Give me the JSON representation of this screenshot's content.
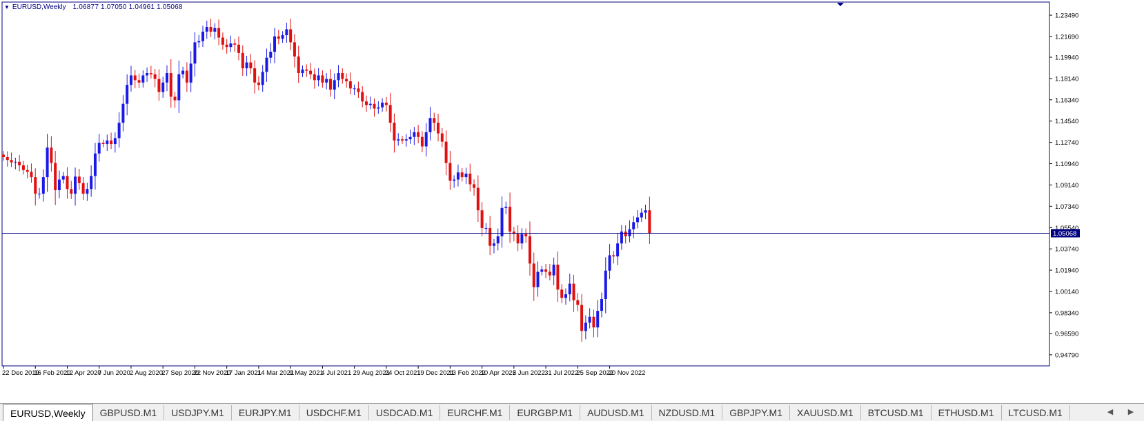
{
  "header": {
    "symbol_label": "EURUSD,Weekly",
    "ohlc_label": "1.06877 1.07050 1.04961 1.05068"
  },
  "colors": {
    "bull": "#1a1ae6",
    "bear": "#e01010",
    "frame": "#000080",
    "price_line": "#000080",
    "price_box": "#000080"
  },
  "tabs": [
    {
      "label": "EURUSD,Weekly",
      "active": true
    },
    {
      "label": "GBPUSD.M1",
      "active": false
    },
    {
      "label": "USDJPY.M1",
      "active": false
    },
    {
      "label": "EURJPY.M1",
      "active": false
    },
    {
      "label": "USDCHF.M1",
      "active": false
    },
    {
      "label": "USDCAD.M1",
      "active": false
    },
    {
      "label": "EURCHF.M1",
      "active": false
    },
    {
      "label": "EURGBP.M1",
      "active": false
    },
    {
      "label": "AUDUSD.M1",
      "active": false
    },
    {
      "label": "NZDUSD.M1",
      "active": false
    },
    {
      "label": "GBPJPY.M1",
      "active": false
    },
    {
      "label": "XAUUSD.M1",
      "active": false
    },
    {
      "label": "BTCUSD.M1",
      "active": false
    },
    {
      "label": "ETHUSD.M1",
      "active": false
    },
    {
      "label": "LTCUSD.M1",
      "active": false
    }
  ],
  "tab_icons": {
    "left": "scroll-left-icon",
    "right": "scroll-right-icon"
  },
  "chart_data": {
    "type": "candlestick",
    "symbol": "EURUSD",
    "timeframe": "Weekly",
    "current_price": 1.05068,
    "current_price_label": "1.05068",
    "ylim": [
      0.9385,
      1.246
    ],
    "grid": false,
    "y_ticks": [
      1.2349,
      1.2169,
      1.1994,
      1.1814,
      1.1634,
      1.1454,
      1.1274,
      1.1094,
      1.0914,
      1.0734,
      1.0554,
      1.0374,
      1.0194,
      1.0014,
      0.9834,
      0.9659,
      0.9479
    ],
    "y_tick_labels": [
      "1.23490",
      "1.21690",
      "1.19940",
      "1.18140",
      "1.16340",
      "1.14540",
      "1.12740",
      "1.10940",
      "1.09140",
      "1.07340",
      "1.05540",
      "1.03740",
      "1.01940",
      "1.00140",
      "0.98340",
      "0.96590",
      "0.94790"
    ],
    "x_ticks": [
      {
        "label": "22 Dec 2019",
        "index": 0
      },
      {
        "label": "16 Feb 2020",
        "index": 8
      },
      {
        "label": "12 Apr 2020",
        "index": 16
      },
      {
        "label": "7 Jun 2020",
        "index": 24
      },
      {
        "label": "2 Aug 2020",
        "index": 32
      },
      {
        "label": "27 Sep 2020",
        "index": 40
      },
      {
        "label": "22 Nov 2020",
        "index": 48
      },
      {
        "label": "17 Jan 2021",
        "index": 56
      },
      {
        "label": "14 Mar 2021",
        "index": 64
      },
      {
        "label": "9 May 2021",
        "index": 72
      },
      {
        "label": "4 Jul 2021",
        "index": 80
      },
      {
        "label": "29 Aug 2021",
        "index": 88
      },
      {
        "label": "24 Oct 2021",
        "index": 96
      },
      {
        "label": "19 Dec 2021",
        "index": 104
      },
      {
        "label": "13 Feb 2022",
        "index": 112
      },
      {
        "label": "10 Apr 2022",
        "index": 120
      },
      {
        "label": "5 Jun 2022",
        "index": 128
      },
      {
        "label": "31 Jul 2022",
        "index": 136
      },
      {
        "label": "25 Sep 2022",
        "index": 144
      },
      {
        "label": "20 Nov 2022",
        "index": 152
      }
    ],
    "close_path": [
      1.115,
      1.1125,
      1.1105,
      1.111,
      1.108,
      1.104,
      1.1025,
      1.098,
      1.084,
      1.084,
      1.098,
      1.123,
      1.11,
      1.087,
      1.096,
      1.099,
      1.088,
      1.084,
      1.0985,
      1.093,
      1.084,
      1.088,
      1.099,
      1.118,
      1.127,
      1.126,
      1.129,
      1.126,
      1.131,
      1.144,
      1.16,
      1.176,
      1.184,
      1.18,
      1.178,
      1.184,
      1.186,
      1.185,
      1.181,
      1.17,
      1.178,
      1.186,
      1.166,
      1.163,
      1.185,
      1.188,
      1.178,
      1.194,
      1.212,
      1.213,
      1.221,
      1.225,
      1.221,
      1.224,
      1.216,
      1.21,
      1.208,
      1.211,
      1.21,
      1.203,
      1.19,
      1.195,
      1.19,
      1.178,
      1.176,
      1.187,
      1.199,
      1.204,
      1.217,
      1.215,
      1.218,
      1.223,
      1.212,
      1.2,
      1.186,
      1.189,
      1.188,
      1.185,
      1.18,
      1.184,
      1.178,
      1.181,
      1.172,
      1.18,
      1.186,
      1.181,
      1.179,
      1.173,
      1.173,
      1.17,
      1.162,
      1.159,
      1.16,
      1.156,
      1.157,
      1.161,
      1.159,
      1.144,
      1.129,
      1.13,
      1.129,
      1.13,
      1.132,
      1.136,
      1.132,
      1.124,
      1.136,
      1.148,
      1.144,
      1.135,
      1.128,
      1.11,
      1.095,
      1.096,
      1.102,
      1.098,
      1.101,
      1.092,
      1.089,
      1.07,
      1.055,
      1.055,
      1.04,
      1.042,
      1.048,
      1.072,
      1.073,
      1.052,
      1.05,
      1.042,
      1.05,
      1.048,
      1.025,
      1.005,
      1.018,
      1.02,
      1.018,
      1.015,
      1.024,
      1.003,
      0.996,
      0.999,
      1.008,
      0.994,
      0.99,
      0.968,
      0.975,
      0.98,
      0.971,
      0.985,
      0.995,
      1.019,
      1.032,
      1.031,
      1.042,
      1.052,
      1.048,
      1.054,
      1.06,
      1.064,
      1.068,
      1.07,
      1.05068
    ]
  }
}
